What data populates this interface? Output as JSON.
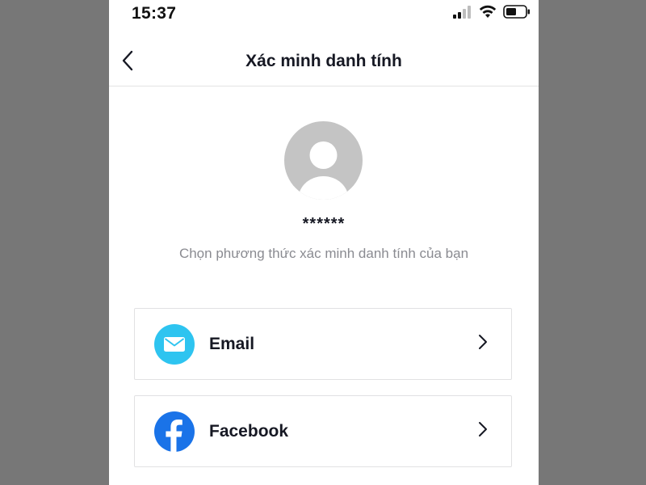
{
  "status_bar": {
    "time": "15:37",
    "icons": [
      "cellular-signal-icon",
      "wifi-icon",
      "battery-icon"
    ]
  },
  "nav": {
    "title": "Xác minh danh tính",
    "back_icon": "chevron-left-icon"
  },
  "profile": {
    "username": "******",
    "avatar_icon": "default-avatar-icon"
  },
  "instruction": "Chọn phương thức xác minh danh tính của bạn",
  "options": [
    {
      "label": "Email",
      "icon": "email-icon",
      "icon_color": "#2ec4f0"
    },
    {
      "label": "Facebook",
      "icon": "facebook-icon",
      "icon_color": "#1a73e8"
    }
  ],
  "colors": {
    "background": "#777777",
    "screen": "#ffffff",
    "title_text": "#161823",
    "secondary_text": "#8a8b91",
    "border": "#e1e1e3",
    "avatar": "#c4c4c4"
  }
}
